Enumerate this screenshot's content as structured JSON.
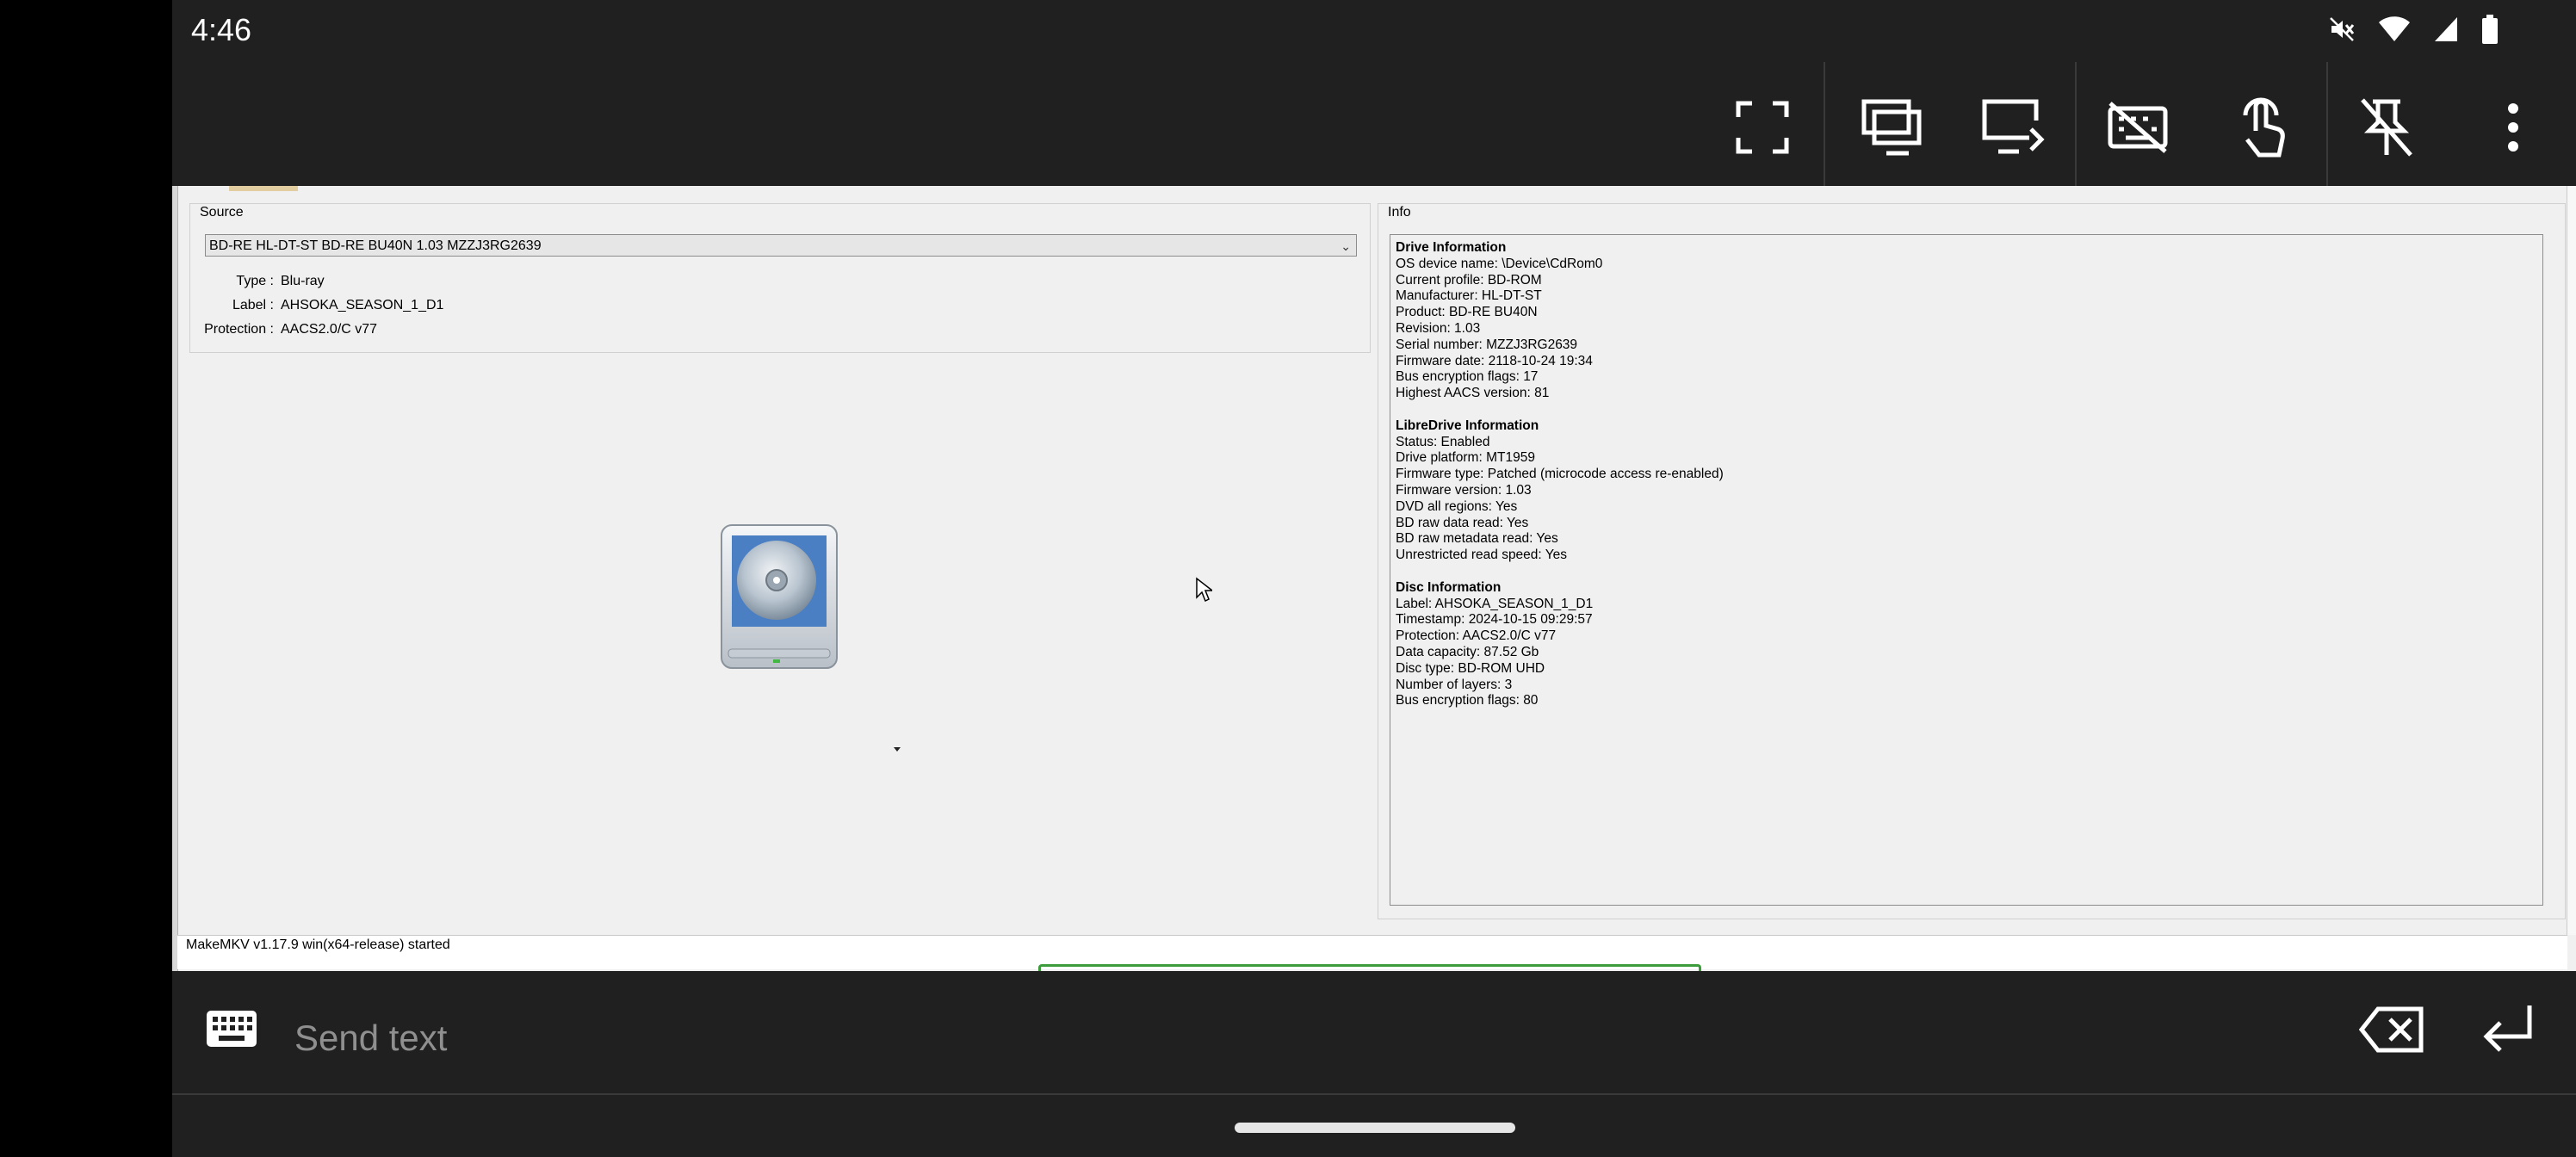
{
  "status_bar": {
    "time": "4:46",
    "icons": [
      "mute-icon",
      "wifi-icon",
      "signal-icon",
      "battery-icon"
    ]
  },
  "remote_toolbar": {
    "buttons": [
      "fullscreen-icon",
      "multi-window-icon",
      "display-switch-icon",
      "keyboard-off-icon",
      "touch-mode-icon",
      "unpin-icon",
      "more-vert-icon"
    ]
  },
  "makemkv": {
    "source": {
      "title": "Source",
      "drive_selected": "BD-RE HL-DT-ST BD-RE BU40N 1.03 MZZJ3RG2639",
      "type_label": "Type :",
      "type_value": "Blu-ray",
      "label_label": "Label :",
      "label_value": "AHSOKA_SEASON_1_D1",
      "protection_label": "Protection :",
      "protection_value": "AACS2.0/C v77"
    },
    "info": {
      "title": "Info",
      "drive": {
        "heading": "Drive Information",
        "lines": [
          "OS device name: \\Device\\CdRom0",
          "Current profile: BD-ROM",
          "Manufacturer: HL-DT-ST",
          "Product: BD-RE BU40N",
          "Revision: 1.03",
          "Serial number: MZZJ3RG2639",
          "Firmware date: 2118-10-24 19:34",
          "Bus encryption flags: 17",
          "Highest AACS version: 81"
        ]
      },
      "libredrive": {
        "heading": "LibreDrive Information",
        "lines": [
          "Status: Enabled",
          "Drive platform: MT1959",
          "Firmware type: Patched (microcode access re-enabled)",
          "Firmware version: 1.03",
          "DVD all regions: Yes",
          "BD raw data read: Yes",
          "BD raw metadata read: Yes",
          "Unrestricted read speed: Yes"
        ]
      },
      "disc": {
        "heading": "Disc Information",
        "lines": [
          "Label: AHSOKA_SEASON_1_D1",
          "Timestamp: 2024-10-15 09:29:57",
          "Protection: AACS2.0/C v77",
          "Data capacity: 87.52 Gb",
          "Disc type: BD-ROM UHD",
          "Number of layers: 3",
          "Bus encryption flags: 80"
        ]
      }
    },
    "status_message": "MakeMKV v1.17.9 win(x64-release) started"
  },
  "input_bar": {
    "placeholder": "Send text"
  },
  "colors": {
    "phone_bg": "#202020",
    "window_bg": "#f0f0f0",
    "progress_green": "#3c9c3c"
  }
}
